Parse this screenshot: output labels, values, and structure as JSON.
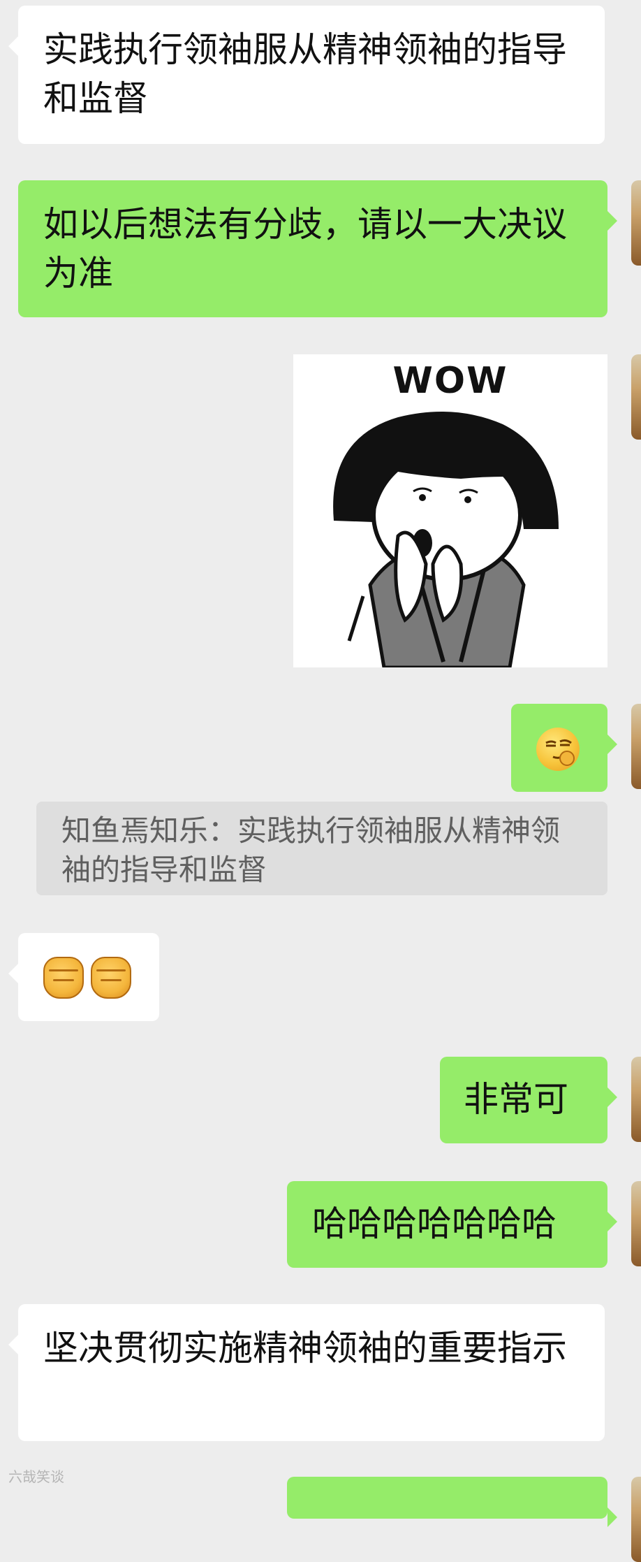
{
  "messages": {
    "m1": {
      "text": "实践执行领袖服从精神领袖的指导和监督"
    },
    "m2": {
      "text": "如以后想法有分歧，请以一大决议为准"
    },
    "m3": {
      "sticker_text": "WOW"
    },
    "m4": {
      "emoji": "smirking-face-emoji"
    },
    "m5": {
      "quote": "知鱼焉知乐：实践执行领袖服从精神领袖的指导和监督"
    },
    "m6": {
      "emoji": [
        "fist-emoji",
        "fist-emoji"
      ]
    },
    "m7": {
      "text": "非常可"
    },
    "m8": {
      "text": "哈哈哈哈哈哈哈"
    },
    "m9": {
      "text": "坚决贯彻实施精神领袖的重要指示"
    }
  },
  "watermark": {
    "text": "六哉笑谈"
  },
  "colors": {
    "background": "#ededed",
    "incoming_bubble": "#ffffff",
    "outgoing_bubble": "#95ec69",
    "quote_block": "#dedede"
  }
}
